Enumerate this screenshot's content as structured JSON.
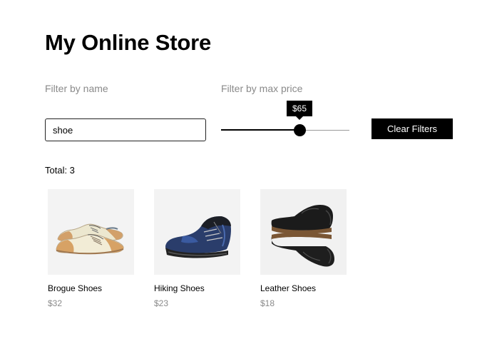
{
  "store": {
    "title": "My Online Store"
  },
  "filters": {
    "name_label": "Filter by name",
    "name_value": "shoe",
    "price_label": "Filter by max price",
    "price_value": 65,
    "price_display": "$65",
    "price_fraction": 0.61,
    "clear_label": "Clear Filters"
  },
  "results": {
    "total_label": "Total: 3"
  },
  "products": [
    {
      "name": "Brogue Shoes",
      "price": "$32",
      "image_icon": "brogue-shoe-image"
    },
    {
      "name": "Hiking Shoes",
      "price": "$23",
      "image_icon": "hiking-boot-image"
    },
    {
      "name": "Leather Shoes",
      "price": "$18",
      "image_icon": "leather-boots-image"
    }
  ]
}
